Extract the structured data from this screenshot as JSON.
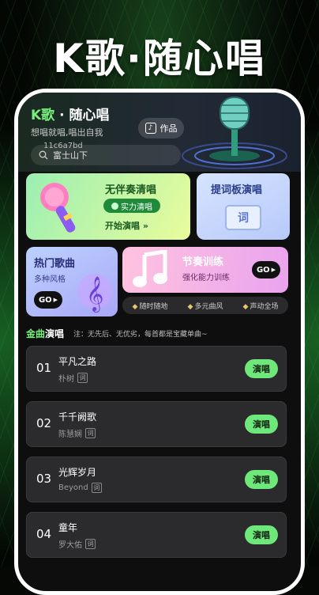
{
  "headline": "K歌·随心唱",
  "app": {
    "title_k": "K歌",
    "title_rest": " · 随心唱",
    "subtitle": "想唱就唱,唱出自我",
    "works_label": "作品",
    "search_value": "11c6a7bd",
    "search_placeholder": "富士山下"
  },
  "cards": {
    "acappella": {
      "title": "无伴奏清唱",
      "badge": "实力清唱",
      "action": "开始演唱 »"
    },
    "teleprompter": {
      "title": "提词板演唱",
      "icon_char": "词"
    },
    "hot": {
      "title": "热门歌曲",
      "subtitle": "多种风格",
      "go": "GO"
    },
    "rhythm": {
      "title": "节奏训练",
      "subtitle": "强化能力训练",
      "go": "GO"
    }
  },
  "tags": [
    "随时随地",
    "多元曲风",
    "声动全场"
  ],
  "section": {
    "title_gold": "金曲",
    "title_rest": "演唱",
    "note": "注：无先后、无优劣，每首都是宝藏单曲~"
  },
  "songs": [
    {
      "no": "01",
      "name": "平凡之路",
      "artist": "朴树",
      "action": "演唱"
    },
    {
      "no": "02",
      "name": "千千阙歌",
      "artist": "陈慧娴",
      "action": "演唱"
    },
    {
      "no": "03",
      "name": "光辉岁月",
      "artist": "Beyond",
      "action": "演唱"
    },
    {
      "no": "04",
      "name": "童年",
      "artist": "罗大佑",
      "action": "演唱"
    }
  ],
  "lyric_char": "词",
  "colors": {
    "accent": "#6ee87a",
    "background": "#0e0e0f"
  }
}
